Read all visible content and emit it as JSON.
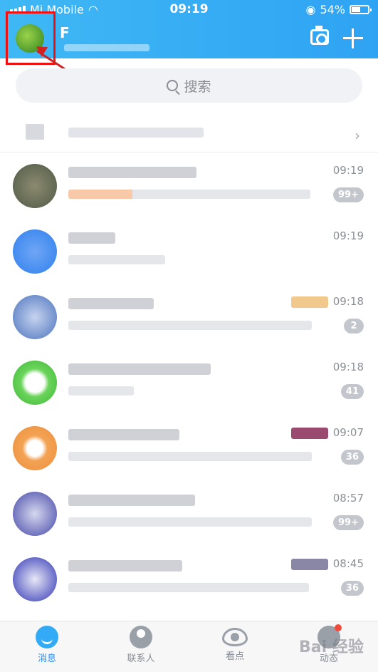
{
  "status_bar": {
    "carrier": "Mi Mobile",
    "time": "09:19",
    "battery": "54%"
  },
  "header": {
    "user_name": "F"
  },
  "search": {
    "label": "搜索"
  },
  "messages": [
    {
      "time": "09:19",
      "badge": "99+",
      "avatar_color": "#6c6a56"
    },
    {
      "time": "09:19",
      "badge": "",
      "avatar_color": "#3b8df0"
    },
    {
      "time": "09:18",
      "badge": "2",
      "avatar_color": "#5d86c8"
    },
    {
      "time": "09:18",
      "badge": "41",
      "avatar_color": "#5ccf4b"
    },
    {
      "time": "09:07",
      "badge": "36",
      "avatar_color": "#f0a150"
    },
    {
      "time": "08:57",
      "badge": "99+",
      "avatar_color": "#4a4fb0"
    },
    {
      "time": "08:45",
      "badge": "36",
      "avatar_color": "#3a3db8"
    }
  ],
  "tabs": [
    {
      "label": "消息",
      "icon": "chat-bubble-icon"
    },
    {
      "label": "联系人",
      "icon": "person-icon"
    },
    {
      "label": "看点",
      "icon": "eye-icon"
    },
    {
      "label": "动态",
      "icon": "star-icon"
    }
  ],
  "watermark": "Bai 经验"
}
